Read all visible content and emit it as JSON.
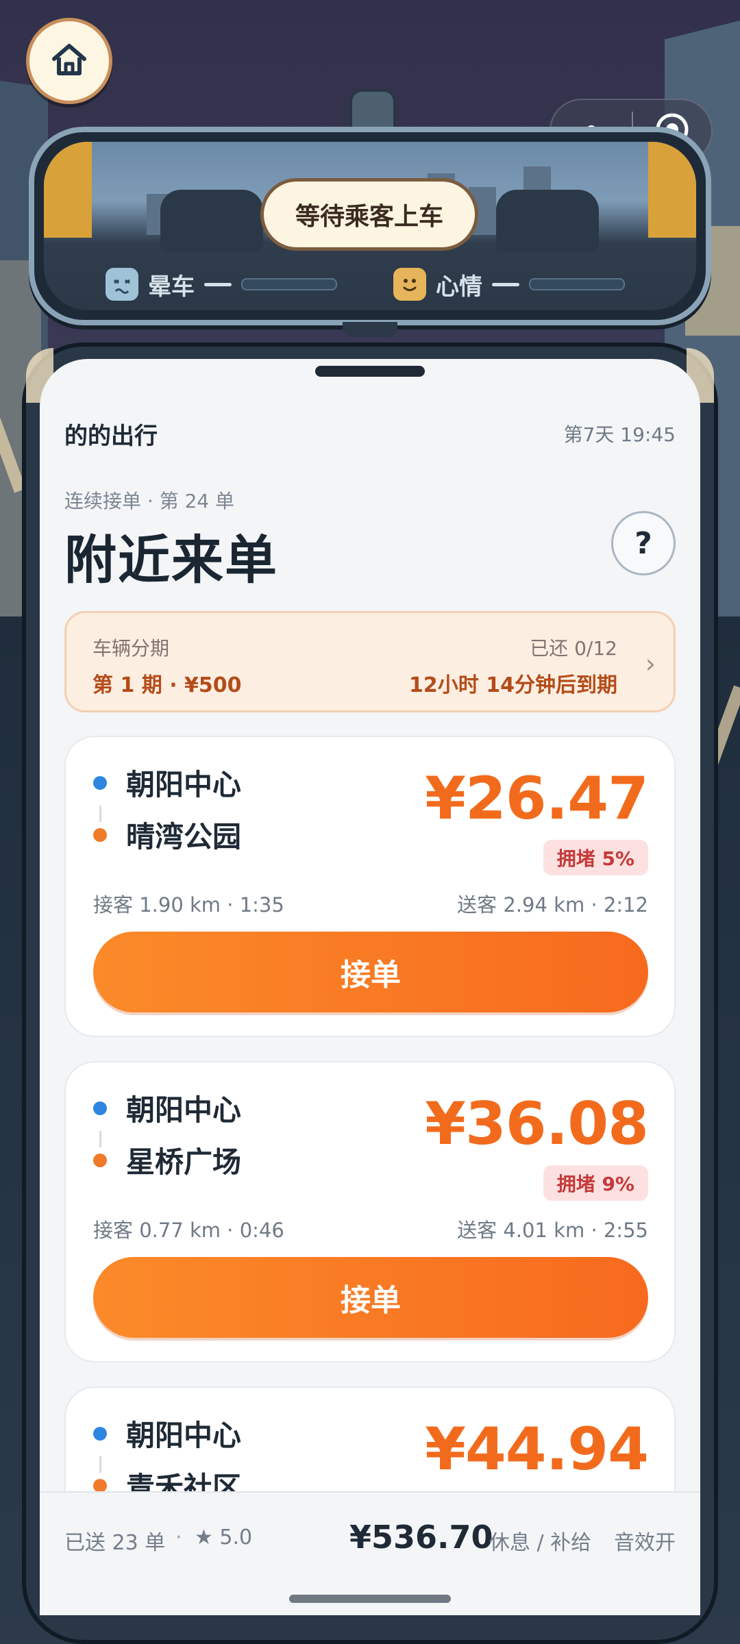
{
  "mirror": {
    "status": "等待乘客上车",
    "motion_sickness_label": "晕车",
    "mood_label": "心情"
  },
  "header": {
    "app_name": "的的出行",
    "day_time": "第7天 19:45"
  },
  "streak": "连续接单 · 第 24 单",
  "page_title": "附近来单",
  "help_label": "?",
  "installment": {
    "label": "车辆分期",
    "value": "第 1 期 · ¥500",
    "paid": "已还 0/12",
    "due": "12小时 14分钟后到期"
  },
  "orders": [
    {
      "from": "朝阳中心",
      "to": "晴湾公园",
      "price": "¥26.47",
      "congestion": "拥堵 5%",
      "pickup": "接客 1.90 km · 1:35",
      "dropoff": "送客 2.94 km · 2:12",
      "accept_label": "接单"
    },
    {
      "from": "朝阳中心",
      "to": "星桥广场",
      "price": "¥36.08",
      "congestion": "拥堵 9%",
      "pickup": "接客 0.77 km · 0:46",
      "dropoff": "送客 4.01 km · 2:55",
      "accept_label": "接单"
    },
    {
      "from": "朝阳中心",
      "to": "青禾社区",
      "price": "¥44.94"
    }
  ],
  "bottom": {
    "delivered": "已送 23 单",
    "separator": "·",
    "rating": "★ 5.0",
    "earnings": "¥536.70",
    "rest": "休息 / 补给",
    "sound": "音效开"
  },
  "colors": {
    "accent": "#f26b1d",
    "pin_origin": "#2f86e0",
    "pin_destination": "#ef7a2a"
  }
}
